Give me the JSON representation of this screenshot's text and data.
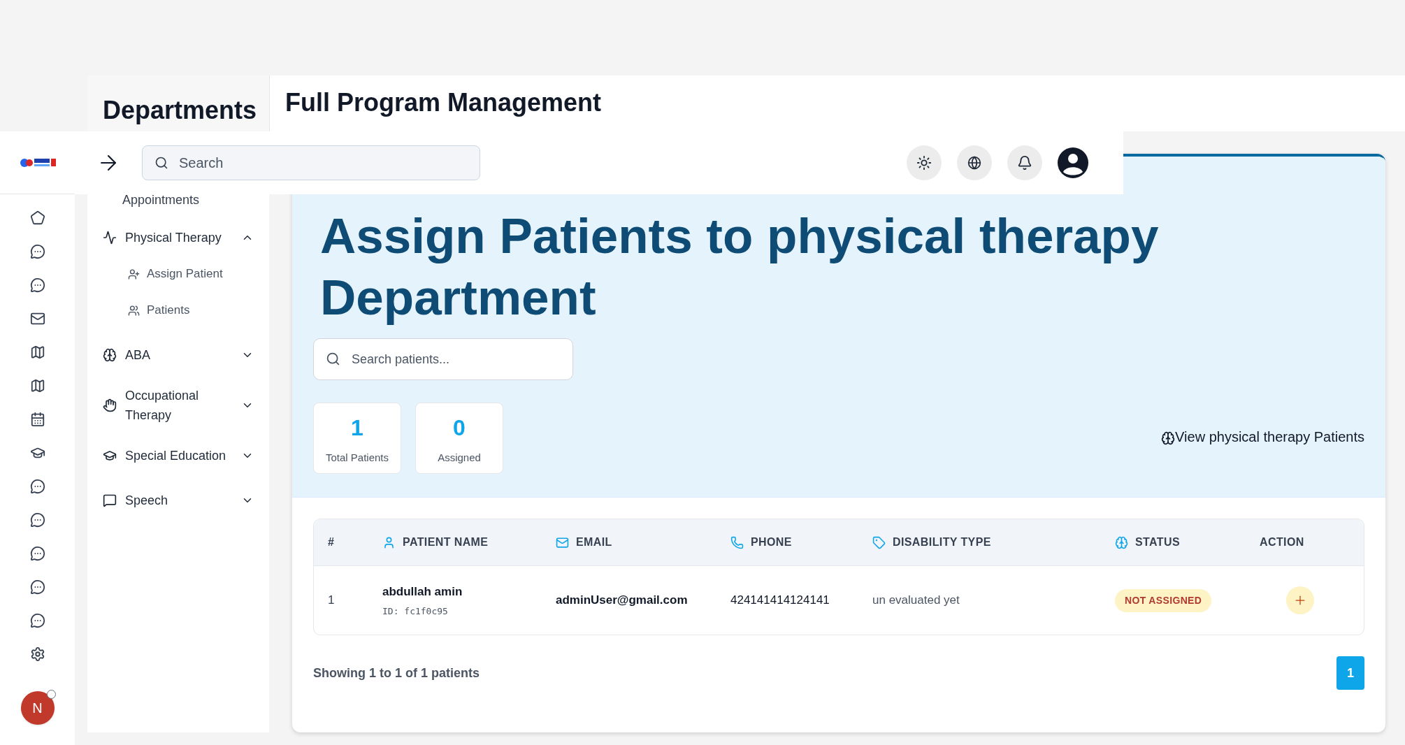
{
  "top": {
    "section": "Departments",
    "title": "Full Program Management"
  },
  "header": {
    "search_placeholder": "Search"
  },
  "rail": {
    "items": [
      {
        "kind": "pentagon"
      },
      {
        "kind": "chat"
      },
      {
        "kind": "chat"
      },
      {
        "kind": "mail"
      },
      {
        "kind": "map"
      },
      {
        "kind": "map"
      },
      {
        "kind": "calendar"
      },
      {
        "kind": "cap"
      },
      {
        "kind": "chat"
      },
      {
        "kind": "chat"
      },
      {
        "kind": "chat"
      },
      {
        "kind": "chat"
      },
      {
        "kind": "chat"
      },
      {
        "kind": "settings"
      }
    ],
    "avatar": "N"
  },
  "sidebar": {
    "cut_item": "Appointments",
    "items": [
      {
        "label": "Physical Therapy",
        "kind": "activity",
        "expanded": true,
        "children": [
          {
            "label": "Assign Patient",
            "kind": "user-plus"
          },
          {
            "label": "Patients",
            "kind": "users"
          }
        ]
      },
      {
        "label": "ABA",
        "kind": "brain",
        "expanded": false
      },
      {
        "label": "Occupational Therapy",
        "kind": "hand",
        "expanded": false
      },
      {
        "label": "Special Education",
        "kind": "cap",
        "expanded": false
      },
      {
        "label": "Speech",
        "kind": "speech",
        "expanded": false
      }
    ]
  },
  "hero": {
    "title": "Assign Patients to physical therapy Department",
    "search_placeholder": "Search patients...",
    "stats": [
      {
        "value": "1",
        "label": "Total Patients"
      },
      {
        "value": "0",
        "label": "Assigned"
      }
    ],
    "link": "View physical therapy Patients"
  },
  "table": {
    "columns": [
      {
        "label": "#",
        "kind": "none"
      },
      {
        "label": "PATIENT NAME",
        "kind": "user"
      },
      {
        "label": "EMAIL",
        "kind": "mail"
      },
      {
        "label": "PHONE",
        "kind": "phone"
      },
      {
        "label": "DISABILITY TYPE",
        "kind": "tag"
      },
      {
        "label": "STATUS",
        "kind": "brain"
      },
      {
        "label": "ACTION",
        "kind": "none"
      }
    ],
    "rows": [
      {
        "index": "1",
        "name": "abdullah amin",
        "id": "ID: fc1f0c95",
        "email": "adminUser@gmail.com",
        "phone": "424141414124141",
        "disability": "un evaluated yet",
        "status": "NOT ASSIGNED"
      }
    ]
  },
  "footer": {
    "summary": "Showing 1 to 1 of 1 patients",
    "pages": [
      {
        "label": "1",
        "selected": true
      }
    ]
  }
}
